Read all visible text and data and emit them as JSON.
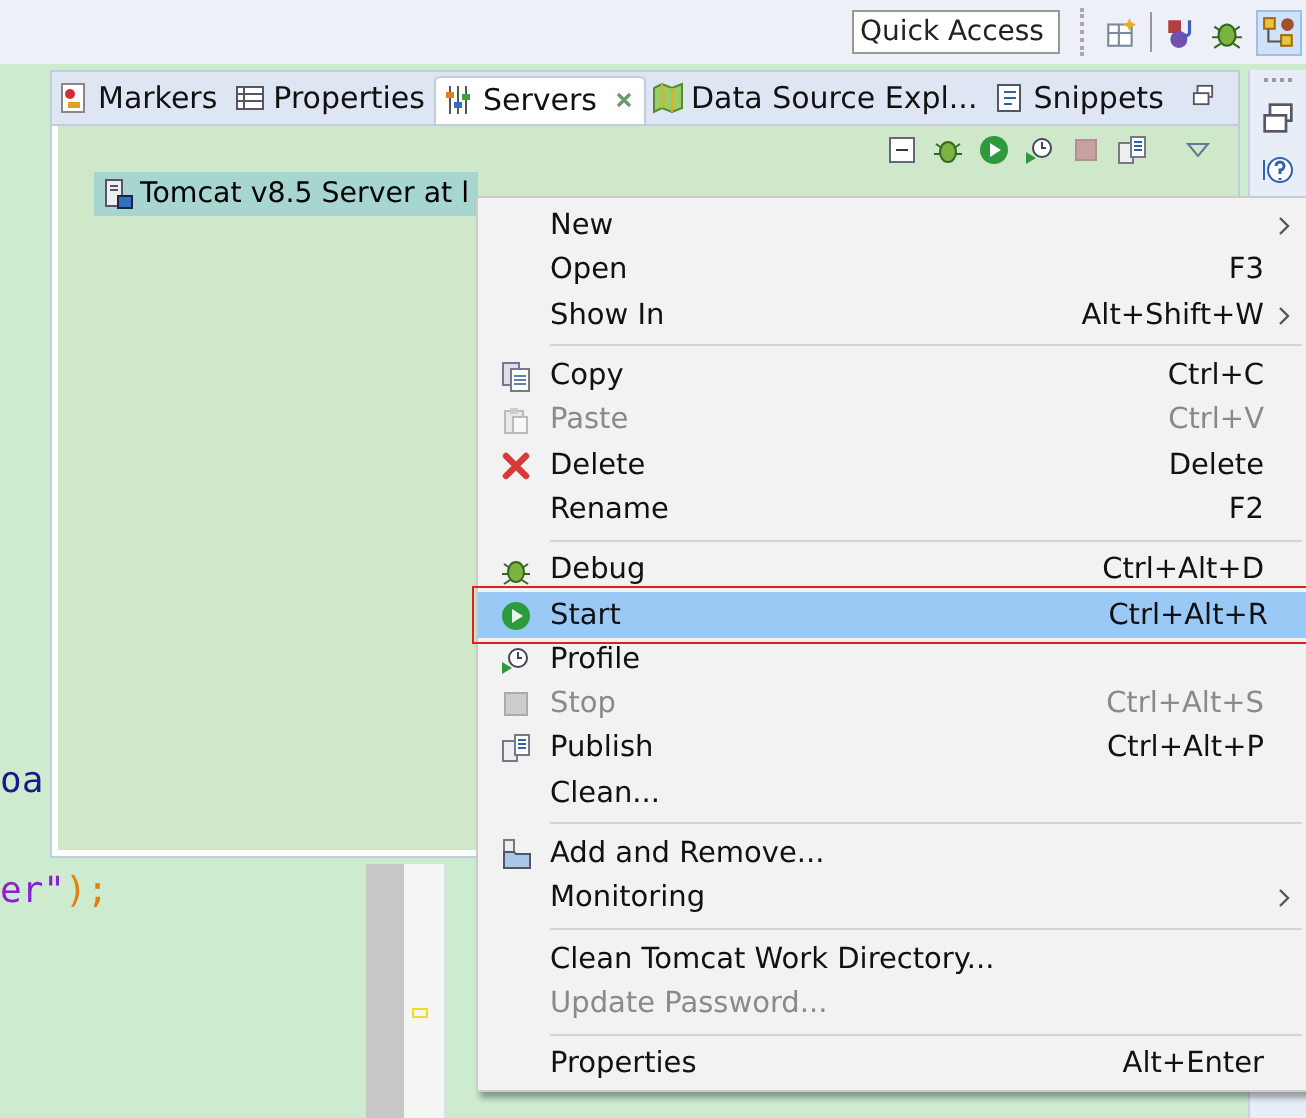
{
  "toolbar": {
    "quick_access": {
      "placeholder": "Quick Access"
    }
  },
  "editor": {
    "lines": [
      {
        "kind": "ident",
        "text": "oa"
      },
      {
        "kind": "string",
        "text": "er\"",
        "tail": ");"
      }
    ]
  },
  "tabs": [
    {
      "label": "Markers",
      "selected": false,
      "kind": "markers"
    },
    {
      "label": "Properties",
      "selected": false,
      "kind": "properties"
    },
    {
      "label": "Servers",
      "selected": true,
      "kind": "servers"
    },
    {
      "label": "Data Source Expl...",
      "selected": false,
      "kind": "datasource"
    },
    {
      "label": "Snippets",
      "selected": false,
      "kind": "snippets"
    }
  ],
  "servers": [
    {
      "label": "Tomcat v8.5 Server at l",
      "selected": true
    }
  ],
  "context_menu": [
    {
      "kind": "plain",
      "label": "New",
      "submenu": true,
      "disabled": false,
      "selected": false
    },
    {
      "kind": "plain",
      "label": "Open",
      "shortcut": "F3",
      "submenu": false,
      "disabled": false,
      "selected": false
    },
    {
      "kind": "plain",
      "label": "Show In",
      "shortcut": "Alt+Shift+W",
      "submenu": true,
      "disabled": false,
      "selected": false
    },
    {
      "kind": "separator"
    },
    {
      "kind": "copy",
      "label": "Copy",
      "shortcut": "Ctrl+C",
      "submenu": false,
      "disabled": false,
      "selected": false
    },
    {
      "kind": "paste",
      "label": "Paste",
      "shortcut": "Ctrl+V",
      "submenu": false,
      "disabled": true,
      "selected": false
    },
    {
      "kind": "delete",
      "label": "Delete",
      "shortcut": "Delete",
      "submenu": false,
      "disabled": false,
      "selected": false
    },
    {
      "kind": "plain",
      "label": "Rename",
      "shortcut": "F2",
      "submenu": false,
      "disabled": false,
      "selected": false
    },
    {
      "kind": "separator"
    },
    {
      "kind": "debug",
      "label": "Debug",
      "shortcut": "Ctrl+Alt+D",
      "submenu": false,
      "disabled": false,
      "selected": false
    },
    {
      "kind": "start",
      "label": "Start",
      "shortcut": "Ctrl+Alt+R",
      "submenu": false,
      "disabled": false,
      "selected": true
    },
    {
      "kind": "profile",
      "label": "Profile",
      "submenu": false,
      "disabled": false,
      "selected": false
    },
    {
      "kind": "stop",
      "label": "Stop",
      "shortcut": "Ctrl+Alt+S",
      "submenu": false,
      "disabled": true,
      "selected": false
    },
    {
      "kind": "publish",
      "label": "Publish",
      "shortcut": "Ctrl+Alt+P",
      "submenu": false,
      "disabled": false,
      "selected": false
    },
    {
      "kind": "plain",
      "label": "Clean...",
      "submenu": false,
      "disabled": false,
      "selected": false
    },
    {
      "kind": "separator"
    },
    {
      "kind": "add",
      "label": "Add and Remove...",
      "submenu": false,
      "disabled": false,
      "selected": false
    },
    {
      "kind": "plain",
      "label": "Monitoring",
      "submenu": true,
      "disabled": false,
      "selected": false
    },
    {
      "kind": "separator"
    },
    {
      "kind": "plain",
      "label": "Clean Tomcat Work Directory...",
      "submenu": false,
      "disabled": false,
      "selected": false
    },
    {
      "kind": "plain",
      "label": "Update Password...",
      "submenu": false,
      "disabled": true,
      "selected": false
    },
    {
      "kind": "separator"
    },
    {
      "kind": "plain",
      "label": "Properties",
      "shortcut": "Alt+Enter",
      "submenu": false,
      "disabled": false,
      "selected": false
    }
  ]
}
